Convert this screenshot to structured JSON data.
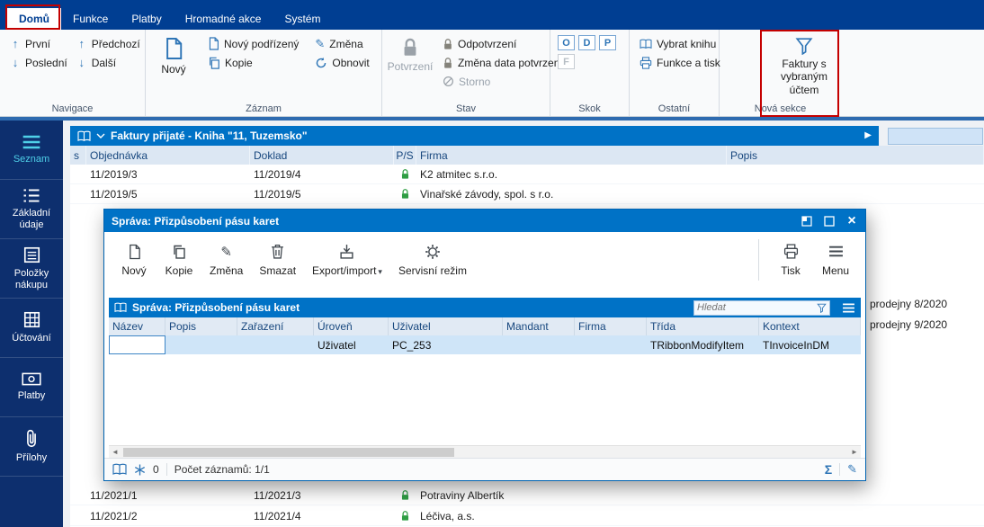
{
  "colors": {
    "accent": "#0072c6",
    "topbar": "#003e92",
    "sidebar": "#0d2f6e",
    "annotation_red": "#c40000",
    "lock_green": "#2f9e44",
    "selected_row": "#cfe5f8"
  },
  "icons": {
    "up_arrow": "↑",
    "down_arrow": "↓",
    "pencil": "✎",
    "play": "▶",
    "close": "×",
    "sum": "Σ",
    "caret_down": "▾",
    "scroll_left": "◄",
    "scroll_right": "►"
  },
  "ribbon": {
    "tabs": [
      {
        "label": "Domů"
      },
      {
        "label": "Funkce"
      },
      {
        "label": "Platby"
      },
      {
        "label": "Hromadné akce"
      },
      {
        "label": "Systém"
      }
    ],
    "navigace": {
      "label": "Navigace",
      "prvni": "První",
      "posledni": "Poslední",
      "predchozi": "Předchozí",
      "dalsi": "Další"
    },
    "zaznam": {
      "label": "Záznam",
      "novy": "Nový",
      "novy_podrizeny": "Nový podřízený",
      "kopie": "Kopie",
      "zmena": "Změna",
      "obnovit": "Obnovit"
    },
    "stav": {
      "label": "Stav",
      "potvrzeni": "Potvrzení",
      "odpotvrzeni": "Odpotvrzení",
      "zmena_data": "Změna data potvrzení",
      "storno": "Storno"
    },
    "skok": {
      "label": "Skok",
      "o": "O",
      "d": "D",
      "p": "P",
      "f": "F"
    },
    "ostatni": {
      "label": "Ostatní",
      "vybrat_knihu": "Vybrat knihu",
      "funkce_tisk": "Funkce a tisk"
    },
    "nova_sekce": {
      "label": "Nová sekce",
      "faktury": "Faktury s vybraným účtem"
    }
  },
  "sidebar": {
    "items": [
      {
        "label": "Seznam"
      },
      {
        "label": "Základní údaje"
      },
      {
        "label": "Položky nákupu"
      },
      {
        "label": "Účtování"
      },
      {
        "label": "Platby"
      },
      {
        "label": "Přílohy"
      }
    ]
  },
  "main_table": {
    "title": "Faktury přijaté - Kniha \"11, Tuzemsko\"",
    "columns": {
      "s": "s",
      "objednavka": "Objednávka",
      "doklad": "Doklad",
      "ps": "P/S",
      "firma": "Firma",
      "popis": "Popis"
    },
    "rows_top": [
      {
        "objednavka": "11/2019/3",
        "doklad": "11/2019/4",
        "firma": "K2 atmitec s.r.o.",
        "popis": ""
      },
      {
        "objednavka": "11/2019/5",
        "doklad": "11/2019/5",
        "firma": "Vinařské závody, spol. s r.o.",
        "popis": ""
      }
    ],
    "partial_rows": [
      {
        "popis": "prodejny 8/2020"
      },
      {
        "popis": "prodejny 9/2020"
      }
    ],
    "rows_bottom": [
      {
        "objednavka": "11/2021/1",
        "doklad": "11/2021/3",
        "firma": "Potraviny Albertík",
        "popis": ""
      },
      {
        "objednavka": "11/2021/2",
        "doklad": "11/2021/4",
        "firma": "Léčiva, a.s.",
        "popis": ""
      }
    ]
  },
  "dialog": {
    "title": "Správa: Přizpůsobení pásu karet",
    "toolbar": {
      "novy": "Nový",
      "kopie": "Kopie",
      "zmena": "Změna",
      "smazat": "Smazat",
      "export_import": "Export/import",
      "servisni": "Servisní režim",
      "tisk": "Tisk",
      "menu": "Menu"
    },
    "list": {
      "title": "Správa: Přizpůsobení pásu karet",
      "search_placeholder": "Hledat",
      "columns": [
        "Název",
        "Popis",
        "Zařazení",
        "Úroveň",
        "Uživatel",
        "Mandant",
        "Firma",
        "Třída",
        "Kontext"
      ],
      "row": {
        "nazev": "",
        "popis": "",
        "zarazeni": "",
        "uroven": "Uživatel",
        "uzivatel": "PC_253",
        "mandant": "",
        "firma": "",
        "trida": "TRibbonModifyItem",
        "kontext": "TInvoiceInDM"
      }
    },
    "status": {
      "badge": "0",
      "records": "Počet záznamů: 1/1"
    }
  }
}
